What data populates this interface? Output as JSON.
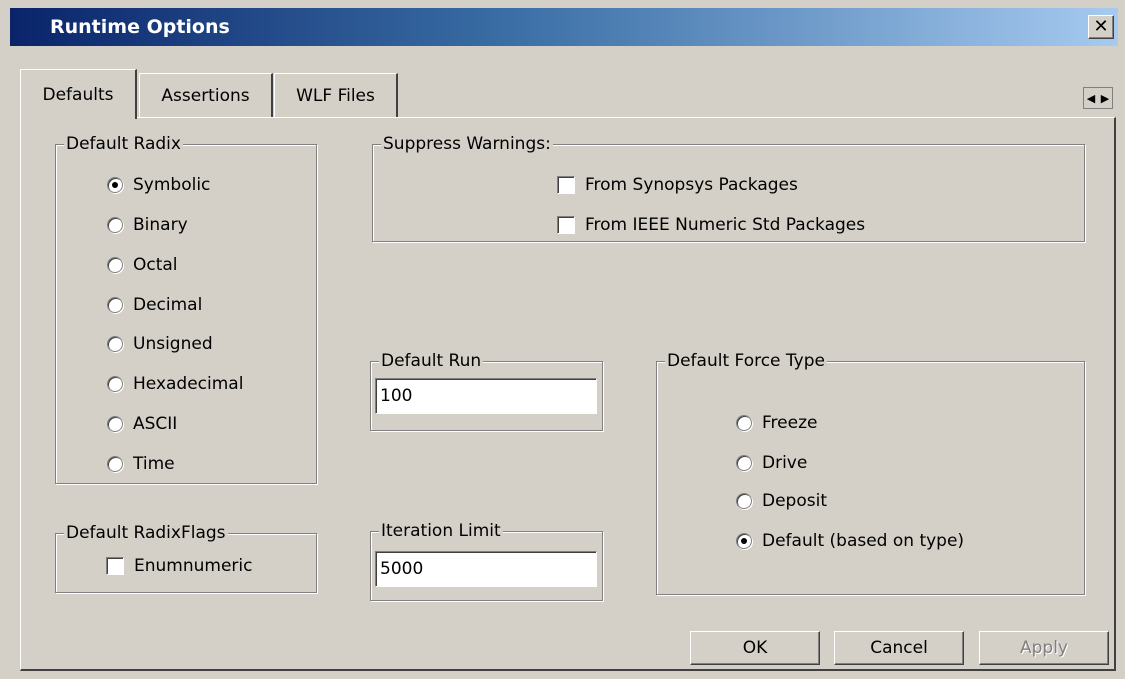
{
  "window": {
    "title": "Runtime Options",
    "close_label": "✕"
  },
  "tabs": [
    {
      "label": "Defaults",
      "active": true
    },
    {
      "label": "Assertions",
      "active": false
    },
    {
      "label": "WLF Files",
      "active": false
    }
  ],
  "tab_scroll": {
    "left": "◀",
    "right": "▶"
  },
  "default_radix": {
    "legend": "Default Radix",
    "options": [
      {
        "label": "Symbolic",
        "selected": true
      },
      {
        "label": "Binary",
        "selected": false
      },
      {
        "label": "Octal",
        "selected": false
      },
      {
        "label": "Decimal",
        "selected": false
      },
      {
        "label": "Unsigned",
        "selected": false
      },
      {
        "label": "Hexadecimal",
        "selected": false
      },
      {
        "label": "ASCII",
        "selected": false
      },
      {
        "label": "Time",
        "selected": false
      }
    ]
  },
  "suppress_warnings": {
    "legend": "Suppress Warnings:",
    "options": [
      {
        "label": "From Synopsys Packages",
        "checked": false
      },
      {
        "label": "From IEEE Numeric Std Packages",
        "checked": false
      }
    ]
  },
  "default_run": {
    "legend": "Default Run",
    "value": "100"
  },
  "iteration_limit": {
    "legend": "Iteration Limit",
    "value": "5000"
  },
  "default_force_type": {
    "legend": "Default Force Type",
    "options": [
      {
        "label": "Freeze",
        "selected": false
      },
      {
        "label": "Drive",
        "selected": false
      },
      {
        "label": "Deposit",
        "selected": false
      },
      {
        "label": "Default (based on type)",
        "selected": true
      }
    ]
  },
  "radix_flags": {
    "legend": "Default RadixFlags",
    "options": [
      {
        "label": "Enumnumeric",
        "checked": false
      }
    ]
  },
  "buttons": {
    "ok": "OK",
    "cancel": "Cancel",
    "apply": "Apply"
  }
}
